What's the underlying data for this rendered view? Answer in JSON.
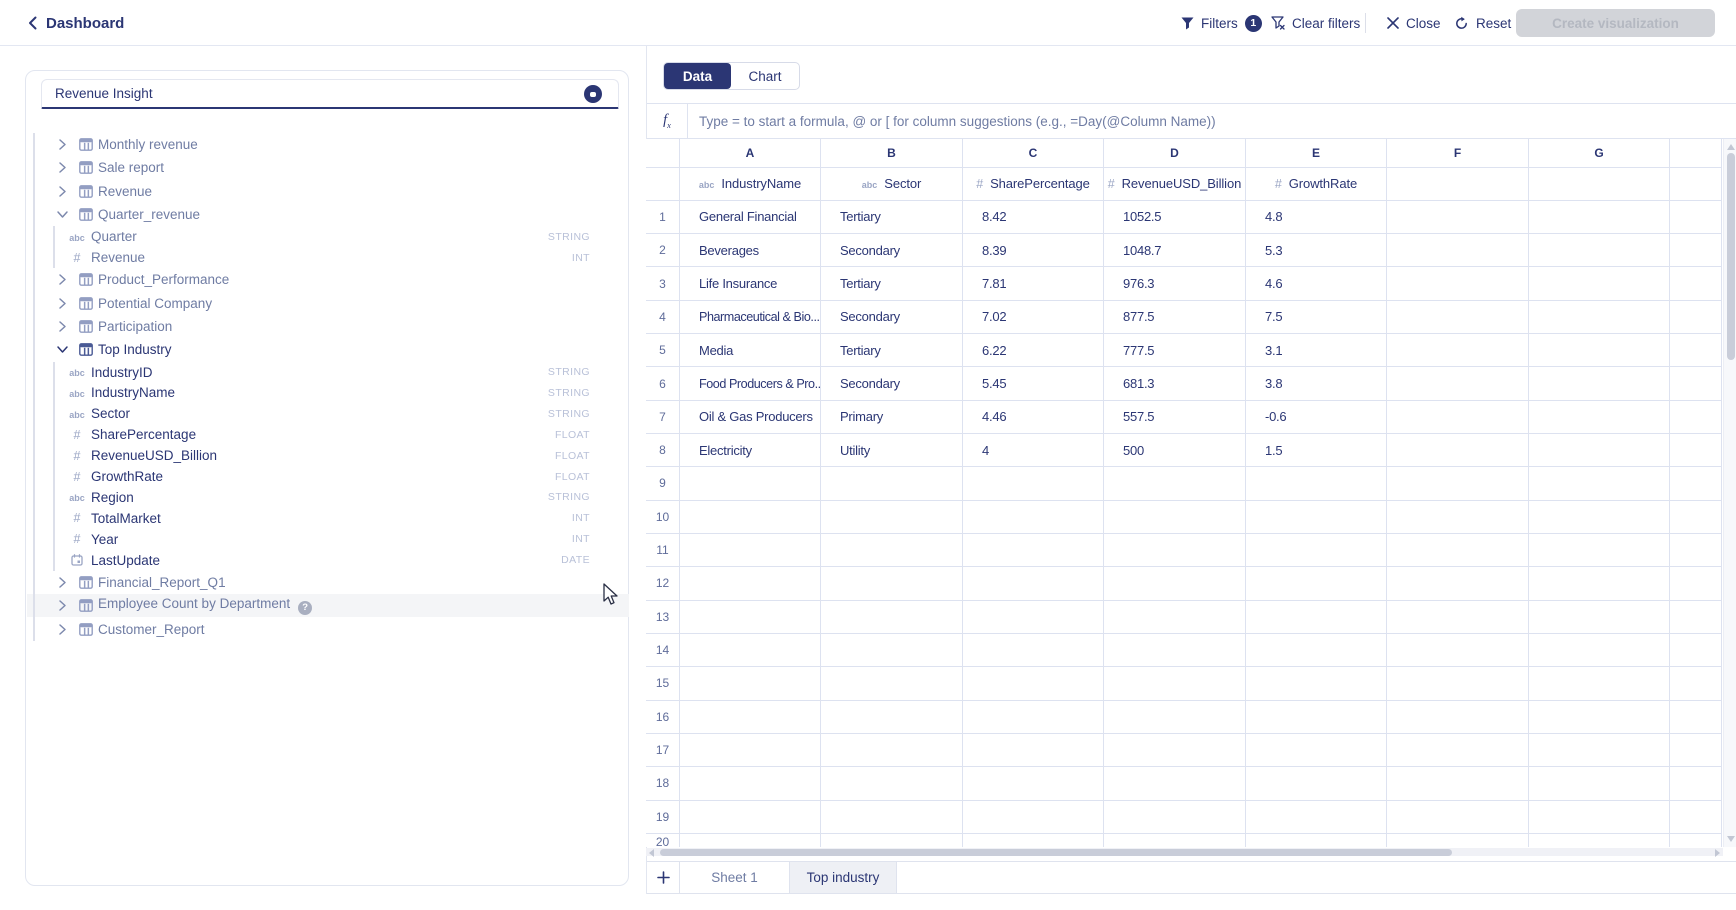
{
  "topbar": {
    "back_label": "Dashboard",
    "filters_label": "Filters",
    "filters_count": "1",
    "clear_filters_label": "Clear filters",
    "close_label": "Close",
    "reset_label": "Reset",
    "create_button_label": "Create visualization"
  },
  "left_panel": {
    "search_value": "Revenue Insight",
    "tree": [
      {
        "label": "Monthly revenue"
      },
      {
        "label": "Sale report"
      },
      {
        "label": "Revenue"
      },
      {
        "label": "Quarter_revenue",
        "expanded": true,
        "children": [
          {
            "label": "Quarter",
            "type": "STRING",
            "icon": "abc"
          },
          {
            "label": "Revenue",
            "type": "INT",
            "icon": "num"
          }
        ]
      },
      {
        "label": "Product_Performance"
      },
      {
        "label": "Potential Company"
      },
      {
        "label": "Participation"
      },
      {
        "label": "Top Industry",
        "expanded": true,
        "active": true,
        "children": [
          {
            "label": "IndustryID",
            "type": "STRING",
            "icon": "abc"
          },
          {
            "label": "IndustryName",
            "type": "STRING",
            "icon": "abc"
          },
          {
            "label": "Sector",
            "type": "STRING",
            "icon": "abc"
          },
          {
            "label": "SharePercentage",
            "type": "FLOAT",
            "icon": "num"
          },
          {
            "label": "RevenueUSD_Billion",
            "type": "FLOAT",
            "icon": "num"
          },
          {
            "label": "GrowthRate",
            "type": "FLOAT",
            "icon": "num"
          },
          {
            "label": "Region",
            "type": "STRING",
            "icon": "abc"
          },
          {
            "label": "TotalMarket",
            "type": "INT",
            "icon": "num"
          },
          {
            "label": "Year",
            "type": "INT",
            "icon": "num"
          },
          {
            "label": "LastUpdate",
            "type": "DATE",
            "icon": "date"
          }
        ]
      },
      {
        "label": "Financial_Report_Q1"
      },
      {
        "label": "Employee Count by Department",
        "hover": true,
        "help": true
      },
      {
        "label": "Customer_Report"
      }
    ]
  },
  "view_tabs": {
    "data": "Data",
    "chart": "Chart"
  },
  "formula_bar": {
    "placeholder": "Type = to start a formula, @ or [ for column suggestions (e.g., =Day(@Column Name))"
  },
  "grid": {
    "column_letters": [
      "A",
      "B",
      "C",
      "D",
      "E",
      "F",
      "G"
    ],
    "fields": [
      {
        "letter": "A",
        "name": "IndustryName",
        "icon": "abc"
      },
      {
        "letter": "B",
        "name": "Sector",
        "icon": "abc"
      },
      {
        "letter": "C",
        "name": "SharePercentage",
        "icon": "num"
      },
      {
        "letter": "D",
        "name": "RevenueUSD_Billion",
        "icon": "num"
      },
      {
        "letter": "E",
        "name": "GrowthRate",
        "icon": "num"
      }
    ],
    "row_count": 20,
    "rows": [
      [
        "General Financial",
        "Tertiary",
        "8.42",
        "1052.5",
        "4.8"
      ],
      [
        "Beverages",
        "Secondary",
        "8.39",
        "1048.7",
        "5.3"
      ],
      [
        "Life Insurance",
        "Tertiary",
        "7.81",
        "976.3",
        "4.6"
      ],
      [
        "Pharmaceutical & Bio...",
        "Secondary",
        "7.02",
        "877.5",
        "7.5"
      ],
      [
        "Media",
        "Tertiary",
        "6.22",
        "777.5",
        "3.1"
      ],
      [
        "Food Producers & Pro...",
        "Secondary",
        "5.45",
        "681.3",
        "3.8"
      ],
      [
        "Oil & Gas Producers",
        "Primary",
        "4.46",
        "557.5",
        "-0.6"
      ],
      [
        "Electricity",
        "Utility",
        "4",
        "500",
        "1.5"
      ]
    ]
  },
  "sheet_bar": {
    "add_label": "+",
    "sheets": [
      {
        "label": "Sheet 1",
        "active": false
      },
      {
        "label": "Top industry",
        "active": true
      }
    ]
  },
  "colors": {
    "navy": "#2b3674",
    "muted_text": "#6f7ca3",
    "type_label": "#b9c1d8",
    "border": "#dde2f0",
    "hover_row": "#f4f5f7",
    "active_sheet_bg": "#eef0f5",
    "disabled_btn_bg": "#d2d4d9",
    "disabled_btn_text": "#b4b8c1"
  }
}
